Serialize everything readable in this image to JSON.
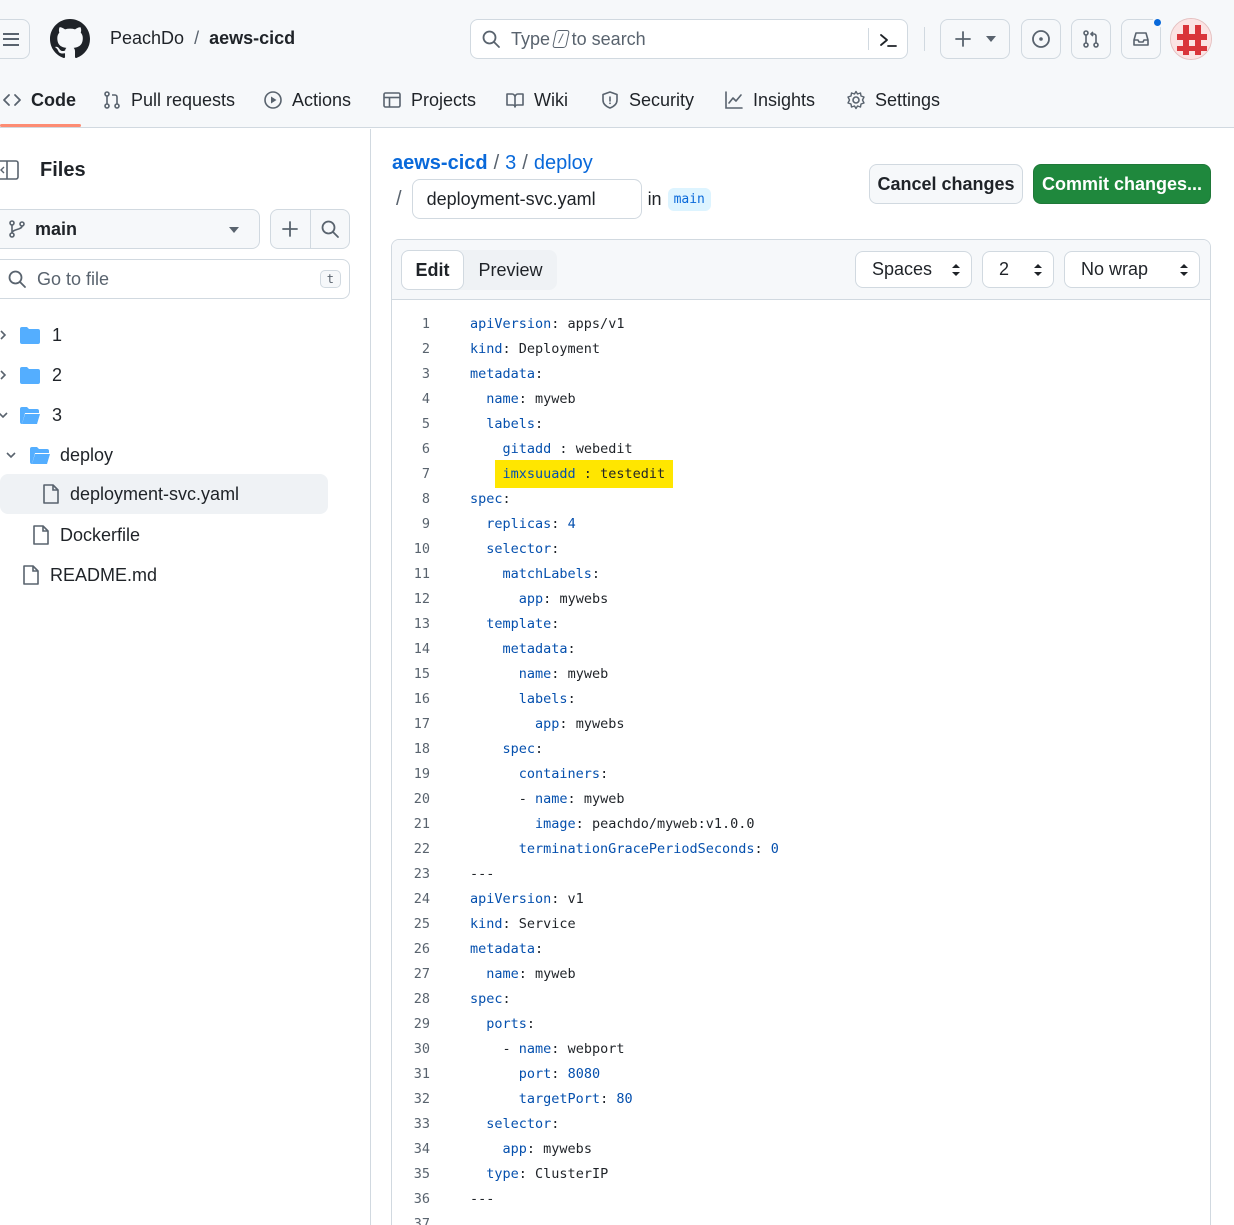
{
  "header": {
    "owner": "PeachDo",
    "separator": "/",
    "repo": "aews-cicd",
    "search_prefix": "Type",
    "search_key": "/",
    "search_suffix": "to search"
  },
  "nav": [
    {
      "label": "Code",
      "icon": "code-icon",
      "active": true
    },
    {
      "label": "Pull requests",
      "icon": "git-pull-request-icon"
    },
    {
      "label": "Actions",
      "icon": "play-icon"
    },
    {
      "label": "Projects",
      "icon": "table-icon"
    },
    {
      "label": "Wiki",
      "icon": "book-icon"
    },
    {
      "label": "Security",
      "icon": "shield-icon"
    },
    {
      "label": "Insights",
      "icon": "graph-icon"
    },
    {
      "label": "Settings",
      "icon": "gear-icon"
    }
  ],
  "sidebar": {
    "title": "Files",
    "branch": "main",
    "goto_placeholder": "Go to file",
    "goto_key": "t",
    "tree": [
      {
        "label": "1",
        "type": "folder"
      },
      {
        "label": "2",
        "type": "folder"
      },
      {
        "label": "3",
        "type": "folder-open"
      },
      {
        "label": "deploy",
        "type": "folder-open"
      },
      {
        "label": "deployment-svc.yaml",
        "type": "file",
        "selected": true
      },
      {
        "label": "Dockerfile",
        "type": "file"
      },
      {
        "label": "README.md",
        "type": "file"
      }
    ]
  },
  "main": {
    "path_repo": "aews-cicd",
    "path_sep": "/",
    "path_dir1": "3",
    "path_dir2": "deploy",
    "filename": "deployment-svc.yaml",
    "in_label": "in",
    "branch": "main",
    "cancel_label": "Cancel changes",
    "commit_label": "Commit changes..."
  },
  "editor": {
    "tab_edit": "Edit",
    "tab_preview": "Preview",
    "indent_mode": "Spaces",
    "indent_size": "2",
    "wrap_mode": "No wrap",
    "highlight_color": "#ffe600"
  },
  "code_lines": [
    "apiVersion: apps/v1",
    "kind: Deployment",
    "metadata:",
    "  name: myweb",
    "  labels:",
    "    gitadd : webedit",
    "    imxsuuadd : testedit",
    "spec:",
    "  replicas: 4",
    "  selector:",
    "    matchLabels:",
    "      app: mywebs",
    "  template:",
    "    metadata:",
    "      name: myweb",
    "      labels:",
    "        app: mywebs",
    "    spec:",
    "      containers:",
    "      - name: myweb",
    "        image: peachdo/myweb:v1.0.0",
    "      terminationGracePeriodSeconds: 0",
    "---",
    "apiVersion: v1",
    "kind: Service",
    "metadata:",
    "  name: myweb",
    "spec:",
    "  ports:",
    "    - name: webport",
    "      port: 8080",
    "      targetPort: 80",
    "  selector:",
    "    app: mywebs",
    "  type: ClusterIP",
    "---",
    ""
  ]
}
